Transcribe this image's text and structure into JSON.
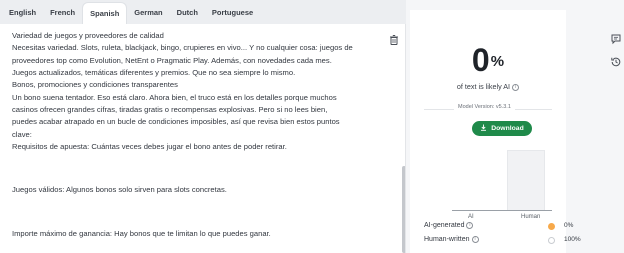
{
  "tabs": [
    "English",
    "French",
    "Spanish",
    "German",
    "Dutch",
    "Portuguese"
  ],
  "active_tab": "Spanish",
  "editor": {
    "lines": [
      "Variedad de juegos y proveedores de calidad",
      "Necesitas variedad. Slots, ruleta, blackjack, bingo, crupieres en vivo... Y no cualquier cosa: juegos de",
      "proveedores top como Evolution, NetEnt o Pragmatic Play. Además, con novedades cada mes.",
      "Juegos actualizados, temáticas diferentes y premios. Que no sea siempre lo mismo.",
      "Bonos, promociones y condiciones transparentes",
      "Un bono suena tentador. Eso está claro. Ahora bien, el truco está en los detalles porque muchos",
      "casinos ofrecen grandes cifras, tiradas gratis o recompensas explosivas. Pero si no lees bien,",
      "puedes acabar atrapado en un bucle de condiciones imposibles, así que revisa bien estos puntos",
      "clave:",
      "Requisitos de apuesta: Cuántas veces debes jugar el bono antes de poder retirar.",
      "Juegos válidos: Algunos bonos solo sirven para slots concretas.",
      "Importe máximo de ganancia: Hay bonos que te limitan lo que puedes ganar."
    ]
  },
  "result": {
    "percent_value": "0",
    "percent_sign": "%",
    "label": "of text is likely AI",
    "model_version": "Model Version: v5.3.1",
    "download_label": "Download"
  },
  "chart_data": {
    "type": "bar",
    "categories": [
      "AI",
      "Human"
    ],
    "values": [
      0,
      100
    ],
    "ylim": [
      0,
      100
    ]
  },
  "legend": [
    {
      "label": "AI-generated",
      "value": "0%",
      "color": "#f7a94a"
    },
    {
      "label": "Human-written",
      "value": "100%",
      "color": "#ffffff"
    }
  ],
  "icons": {
    "trash": "trash-icon",
    "comment": "comment-icon",
    "history": "history-icon",
    "info": "info-icon",
    "download": "download-icon"
  }
}
